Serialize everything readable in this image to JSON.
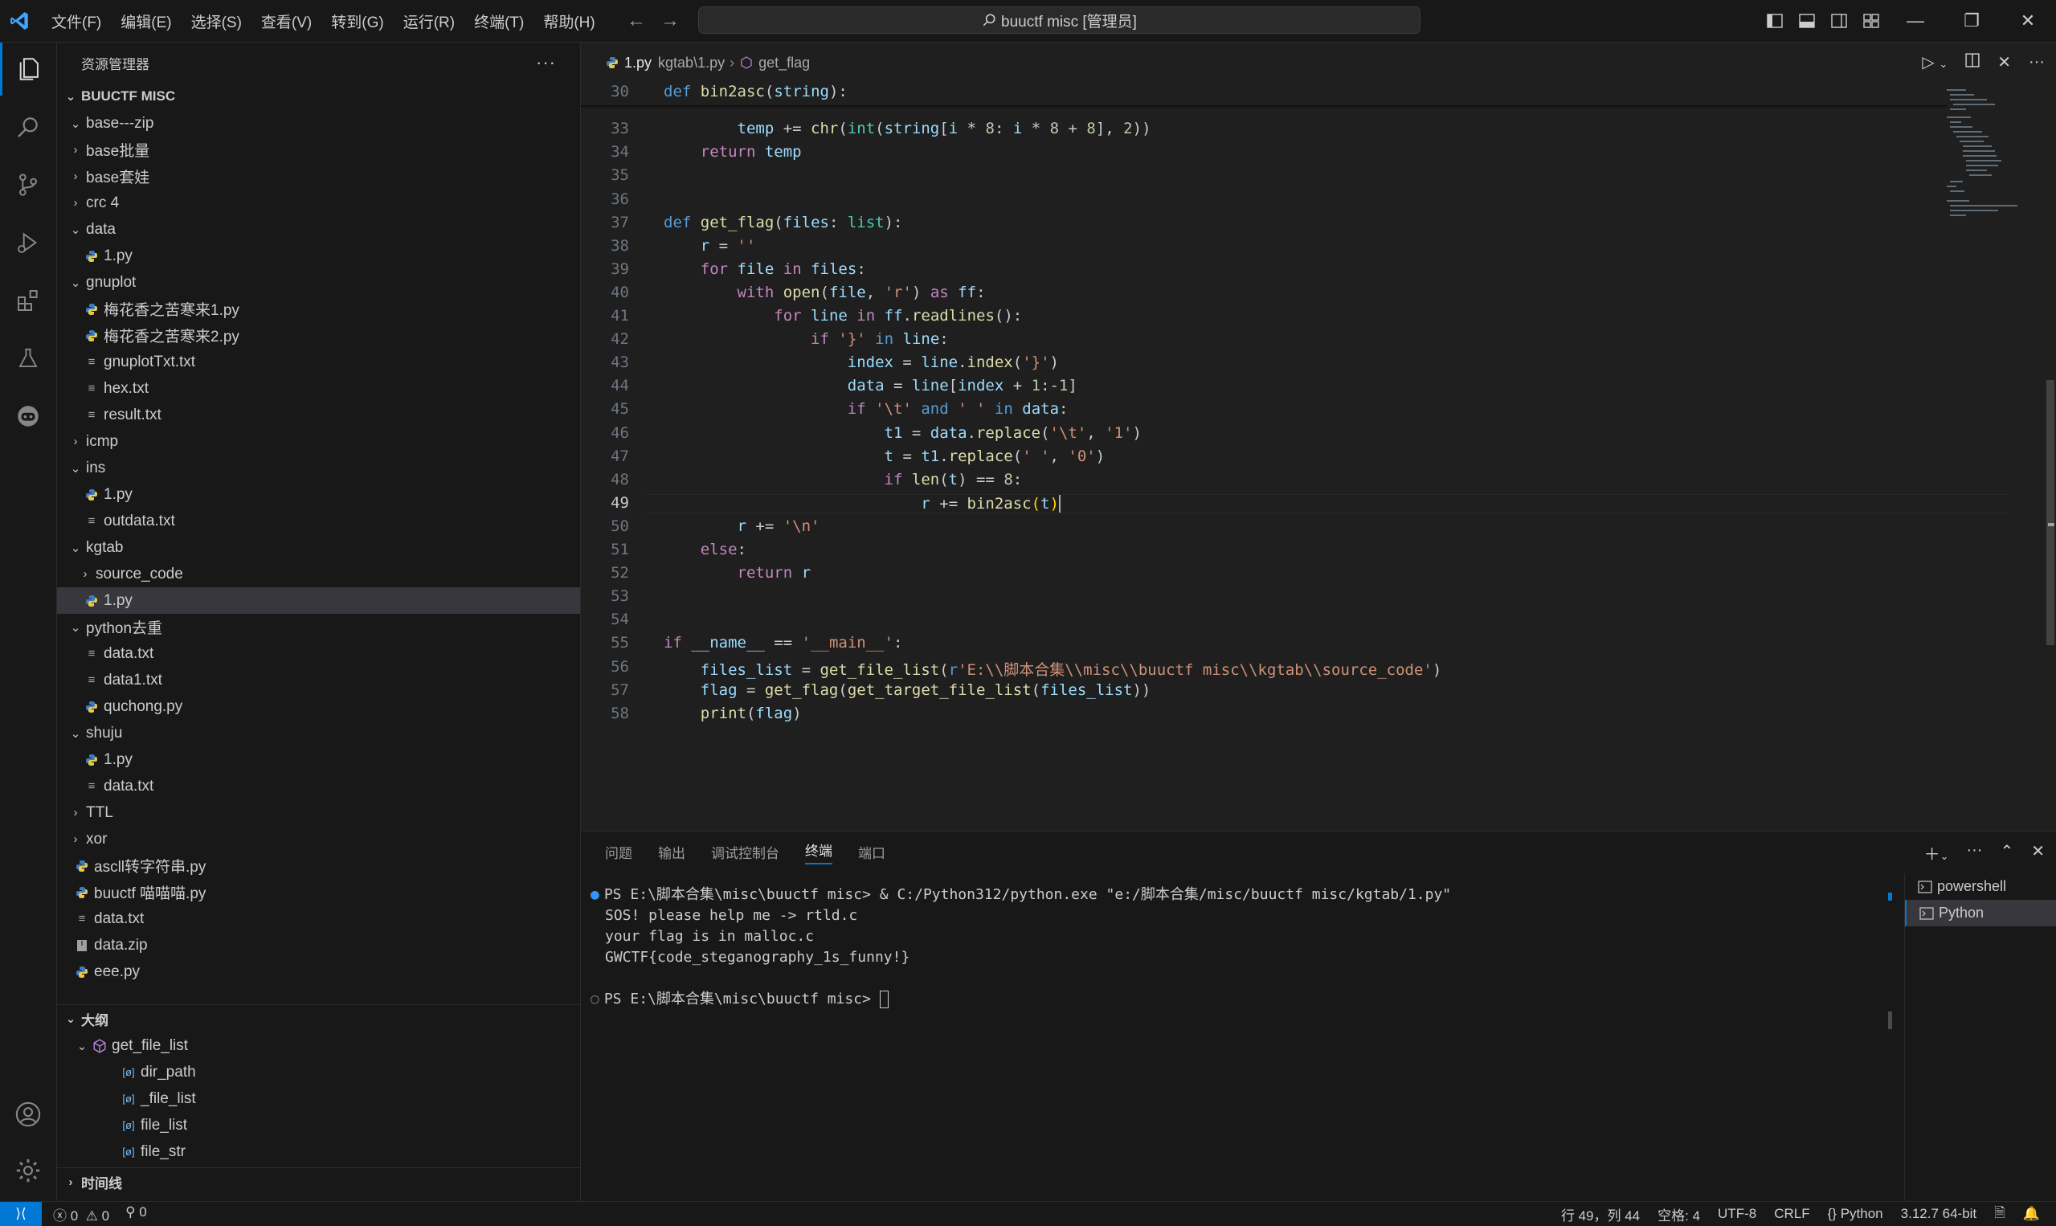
{
  "menu": [
    "文件(F)",
    "编辑(E)",
    "选择(S)",
    "查看(V)",
    "转到(G)",
    "运行(R)",
    "终端(T)",
    "帮助(H)"
  ],
  "command_center": "buuctf misc [管理员]",
  "explorer": {
    "title": "资源管理器",
    "folder": "BUUCTF MISC",
    "items": [
      {
        "label": "base---zip",
        "depth": 0,
        "type": "folder",
        "open": true
      },
      {
        "label": "base批量",
        "depth": 0,
        "type": "folder",
        "open": false
      },
      {
        "label": "base套娃",
        "depth": 0,
        "type": "folder",
        "open": false
      },
      {
        "label": "crc 4",
        "depth": 0,
        "type": "folder",
        "open": false
      },
      {
        "label": "data",
        "depth": 0,
        "type": "folder",
        "open": true
      },
      {
        "label": "1.py",
        "depth": 1,
        "type": "py"
      },
      {
        "label": "gnuplot",
        "depth": 0,
        "type": "folder",
        "open": true
      },
      {
        "label": "梅花香之苦寒来1.py",
        "depth": 1,
        "type": "py"
      },
      {
        "label": "梅花香之苦寒来2.py",
        "depth": 1,
        "type": "py"
      },
      {
        "label": "gnuplotTxt.txt",
        "depth": 1,
        "type": "txt"
      },
      {
        "label": "hex.txt",
        "depth": 1,
        "type": "txt"
      },
      {
        "label": "result.txt",
        "depth": 1,
        "type": "txt"
      },
      {
        "label": "icmp",
        "depth": 0,
        "type": "folder",
        "open": false
      },
      {
        "label": "ins",
        "depth": 0,
        "type": "folder",
        "open": true
      },
      {
        "label": "1.py",
        "depth": 1,
        "type": "py"
      },
      {
        "label": "outdata.txt",
        "depth": 1,
        "type": "txt"
      },
      {
        "label": "kgtab",
        "depth": 0,
        "type": "folder",
        "open": true
      },
      {
        "label": "source_code",
        "depth": 1,
        "type": "folder",
        "open": false
      },
      {
        "label": "1.py",
        "depth": 1,
        "type": "py",
        "selected": true
      },
      {
        "label": "python去重",
        "depth": 0,
        "type": "folder",
        "open": true
      },
      {
        "label": "data.txt",
        "depth": 1,
        "type": "txt"
      },
      {
        "label": "data1.txt",
        "depth": 1,
        "type": "txt"
      },
      {
        "label": "quchong.py",
        "depth": 1,
        "type": "py"
      },
      {
        "label": "shuju",
        "depth": 0,
        "type": "folder",
        "open": true
      },
      {
        "label": "1.py",
        "depth": 1,
        "type": "py"
      },
      {
        "label": "data.txt",
        "depth": 1,
        "type": "txt"
      },
      {
        "label": "TTL",
        "depth": 0,
        "type": "folder",
        "open": false
      },
      {
        "label": "xor",
        "depth": 0,
        "type": "folder",
        "open": false
      },
      {
        "label": "ascll转字符串.py",
        "depth": 0,
        "type": "py"
      },
      {
        "label": "buuctf 喵喵喵.py",
        "depth": 0,
        "type": "py"
      },
      {
        "label": "data.txt",
        "depth": 0,
        "type": "txt"
      },
      {
        "label": "data.zip",
        "depth": 0,
        "type": "zip"
      },
      {
        "label": "eee.py",
        "depth": 0,
        "type": "py"
      }
    ]
  },
  "outline": {
    "title": "大纲",
    "root": "get_file_list",
    "items": [
      "dir_path",
      "_file_list",
      "file_list",
      "file_str"
    ]
  },
  "timeline": {
    "title": "时间线"
  },
  "editor": {
    "tab": "1.py",
    "breadcrumb": [
      "kgtab\\1.py",
      "get_flag"
    ],
    "current_line": 49,
    "lines": [
      {
        "n": 30,
        "html": "<span class=\"kd\">def</span> <span class=\"fn\">bin2asc</span>(<span class=\"vr\">string</span>):"
      },
      {
        "n": 33,
        "html": "        <span class=\"vr\">temp</span> += <span class=\"fn\">chr</span>(<span class=\"cls\">int</span>(<span class=\"vr\">string</span>[<span class=\"vr\">i</span> * <span class=\"nm\">8</span>: <span class=\"vr\">i</span> * <span class=\"nm\">8</span> + <span class=\"nm\">8</span>], <span class=\"nm\">2</span>))"
      },
      {
        "n": 34,
        "html": "    <span class=\"kw\">return</span> <span class=\"vr\">temp</span>"
      },
      {
        "n": 35,
        "html": ""
      },
      {
        "n": 36,
        "html": ""
      },
      {
        "n": 37,
        "html": "<span class=\"kd\">def</span> <span class=\"fn\">get_flag</span>(<span class=\"vr\">files</span>: <span class=\"cls\">list</span>):"
      },
      {
        "n": 38,
        "html": "    <span class=\"vr\">r</span> = <span class=\"st\">''</span>"
      },
      {
        "n": 39,
        "html": "    <span class=\"kw\">for</span> <span class=\"vr\">file</span> <span class=\"kw\">in</span> <span class=\"vr\">files</span>:"
      },
      {
        "n": 40,
        "html": "        <span class=\"kw\">with</span> <span class=\"fn\">open</span>(<span class=\"vr\">file</span>, <span class=\"st\">'r'</span>) <span class=\"kw\">as</span> <span class=\"vr\">ff</span>:"
      },
      {
        "n": 41,
        "html": "            <span class=\"kw\">for</span> <span class=\"vr\">line</span> <span class=\"kw\">in</span> <span class=\"vr\">ff</span>.<span class=\"fn\">readlines</span>():"
      },
      {
        "n": 42,
        "html": "                <span class=\"kw\">if</span> <span class=\"st\">'}'</span> <span class=\"kd\">in</span> <span class=\"vr\">line</span>:"
      },
      {
        "n": 43,
        "html": "                    <span class=\"vr\">index</span> = <span class=\"vr\">line</span>.<span class=\"fn\">index</span>(<span class=\"st\">'}'</span>)"
      },
      {
        "n": 44,
        "html": "                    <span class=\"vr\">data</span> = <span class=\"vr\">line</span>[<span class=\"vr\">index</span> + <span class=\"nm\">1</span>:-<span class=\"nm\">1</span>]"
      },
      {
        "n": 45,
        "html": "                    <span class=\"kw\">if</span> <span class=\"st\">'\\t'</span> <span class=\"kd\">and</span> <span class=\"st\">' '</span> <span class=\"kd\">in</span> <span class=\"vr\">data</span>:"
      },
      {
        "n": 46,
        "html": "                        <span class=\"vr\">t1</span> = <span class=\"vr\">data</span>.<span class=\"fn\">replace</span>(<span class=\"st\">'\\t'</span>, <span class=\"st\">'1'</span>)"
      },
      {
        "n": 47,
        "html": "                        <span class=\"vr\">t</span> = <span class=\"vr\">t1</span>.<span class=\"fn\">replace</span>(<span class=\"st\">' '</span>, <span class=\"st\">'0'</span>)"
      },
      {
        "n": 48,
        "html": "                        <span class=\"kw\">if</span> <span class=\"fn\">len</span>(<span class=\"vr\">t</span>) == <span class=\"nm\">8</span>:"
      },
      {
        "n": 49,
        "html": "                            <span class=\"vr\">r</span> += <span class=\"fn\">bin2asc</span><span class=\"bk\">(</span><span class=\"vr\">t</span><span class=\"bk\">)</span>"
      },
      {
        "n": 50,
        "html": "        <span class=\"vr\">r</span> += <span class=\"st\">'\\n'</span>"
      },
      {
        "n": 51,
        "html": "    <span class=\"kw\">else</span>:"
      },
      {
        "n": 52,
        "html": "        <span class=\"kw\">return</span> <span class=\"vr\">r</span>"
      },
      {
        "n": 53,
        "html": ""
      },
      {
        "n": 54,
        "html": ""
      },
      {
        "n": 55,
        "html": "<span class=\"kw\">if</span> <span class=\"vr\">__name__</span> == <span class=\"st\">'__main__'</span>:"
      },
      {
        "n": 56,
        "html": "    <span class=\"vr\">files_list</span> = <span class=\"fn\">get_file_list</span>(<span class=\"kd\">r</span><span class=\"st\">'E:\\\\脚本合集\\\\misc\\\\buuctf misc\\\\kgtab\\\\source_code'</span>)"
      },
      {
        "n": 57,
        "html": "    <span class=\"vr\">flag</span> = <span class=\"fn\">get_flag</span>(<span class=\"fn\">get_target_file_list</span>(<span class=\"vr\">files_list</span>))"
      },
      {
        "n": 58,
        "html": "    <span class=\"fn\">print</span>(<span class=\"vr\">flag</span>)"
      }
    ]
  },
  "panel": {
    "tabs": [
      "问题",
      "输出",
      "调试控制台",
      "终端",
      "端口"
    ],
    "active_tab": "终端",
    "terminal_lines": [
      "PS E:\\脚本合集\\misc\\buuctf misc> & C:/Python312/python.exe \"e:/脚本合集/misc/buuctf misc/kgtab/1.py\"",
      "SOS! please help me -> rtld.c",
      "your flag is in malloc.c",
      "GWCTF{code_steganography_1s_funny!}",
      "",
      "PS E:\\脚本合集\\misc\\buuctf misc> "
    ],
    "terminals": [
      "powershell",
      "Python"
    ]
  },
  "status": {
    "errors": "0",
    "warnings": "0",
    "ports": "0",
    "position": "行 49，列 44",
    "spaces": "空格: 4",
    "encoding": "UTF-8",
    "eol": "CRLF",
    "language": "Python",
    "interpreter": "3.12.7 64-bit"
  }
}
